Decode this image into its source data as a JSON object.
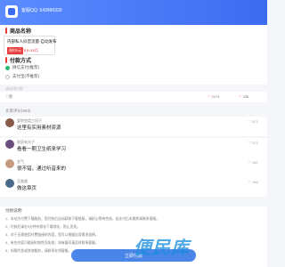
{
  "header": {
    "text": "客服QQ: 543990320"
  },
  "product": {
    "section_title": "商品名称",
    "name": "内部私人抖音流量-自动发布",
    "tag": "限时5元",
    "price": "￥6.00/月"
  },
  "payment": {
    "section_title": "付款方式",
    "options": [
      {
        "label": "微信支付(推荐)"
      },
      {
        "label": "支付宝(不推荐)"
      }
    ]
  },
  "hint": "请选择付款",
  "stats": {
    "like_label": "♡赞",
    "count_a": "2174",
    "count_b": "336"
  },
  "comments": {
    "header": "买家评价(983)",
    "items": [
      {
        "name": "爱转悠盘工班子",
        "text": "这里有实用素材资源",
        "likes": "671",
        "avatar_color": "#8a5a4a"
      },
      {
        "name": "星辰有光子",
        "text": "看看一期卫生纸来学习",
        "likes": "571",
        "avatar_color": "#6a4f7e"
      },
      {
        "name": "女气",
        "text": "很不错，通过听音来的",
        "likes": "467",
        "avatar_color": "#c59a82"
      },
      {
        "name": "至美美",
        "text": "做这章页",
        "likes": "462",
        "avatar_color": "#4a6a8a"
      }
    ]
  },
  "notes": {
    "title": "付款说明:",
    "items": [
      "1、本站为付费下载服务，您付款后自动获取下载链接，请耐心等待完成，若支付后未跳转请联系客服。",
      "2、付款后请在5分钟内保存下载地址，防止丢失。",
      "3、对于无需使用付费链接的内容，您可以根据自身需求选择。",
      "4、有些内容可能因时效性而失效，如有疑问请及时联系客服。",
      "5、如需代发或其他服务，请联系在线客服。"
    ]
  },
  "pay_button": {
    "label": "立即付款"
  },
  "watermark": {
    "text": "便民库"
  }
}
